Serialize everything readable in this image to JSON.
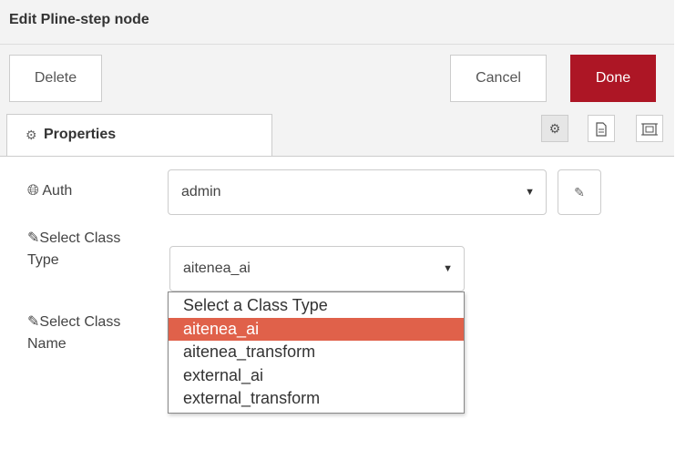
{
  "dialog": {
    "title": "Edit Pline-step node"
  },
  "toolbar": {
    "delete_label": "Delete",
    "cancel_label": "Cancel",
    "done_label": "Done",
    "done_color": "#ad1625"
  },
  "tabs": {
    "properties_label": "Properties",
    "icons": [
      "gear-icon",
      "document-icon",
      "frame-icon"
    ]
  },
  "form": {
    "auth": {
      "label": "Auth",
      "value": "admin"
    },
    "class_type": {
      "label_line1": "Select Class",
      "label_line2": "Type",
      "value": "aitenea_ai"
    },
    "class_name": {
      "label_line1": "Select Class",
      "label_line2": "Name"
    }
  },
  "dropdown": {
    "options": [
      "Select a Class Type",
      "aitenea_ai",
      "aitenea_transform",
      "external_ai",
      "external_transform"
    ],
    "selected": "aitenea_ai",
    "highlight_color": "#e0614a"
  }
}
